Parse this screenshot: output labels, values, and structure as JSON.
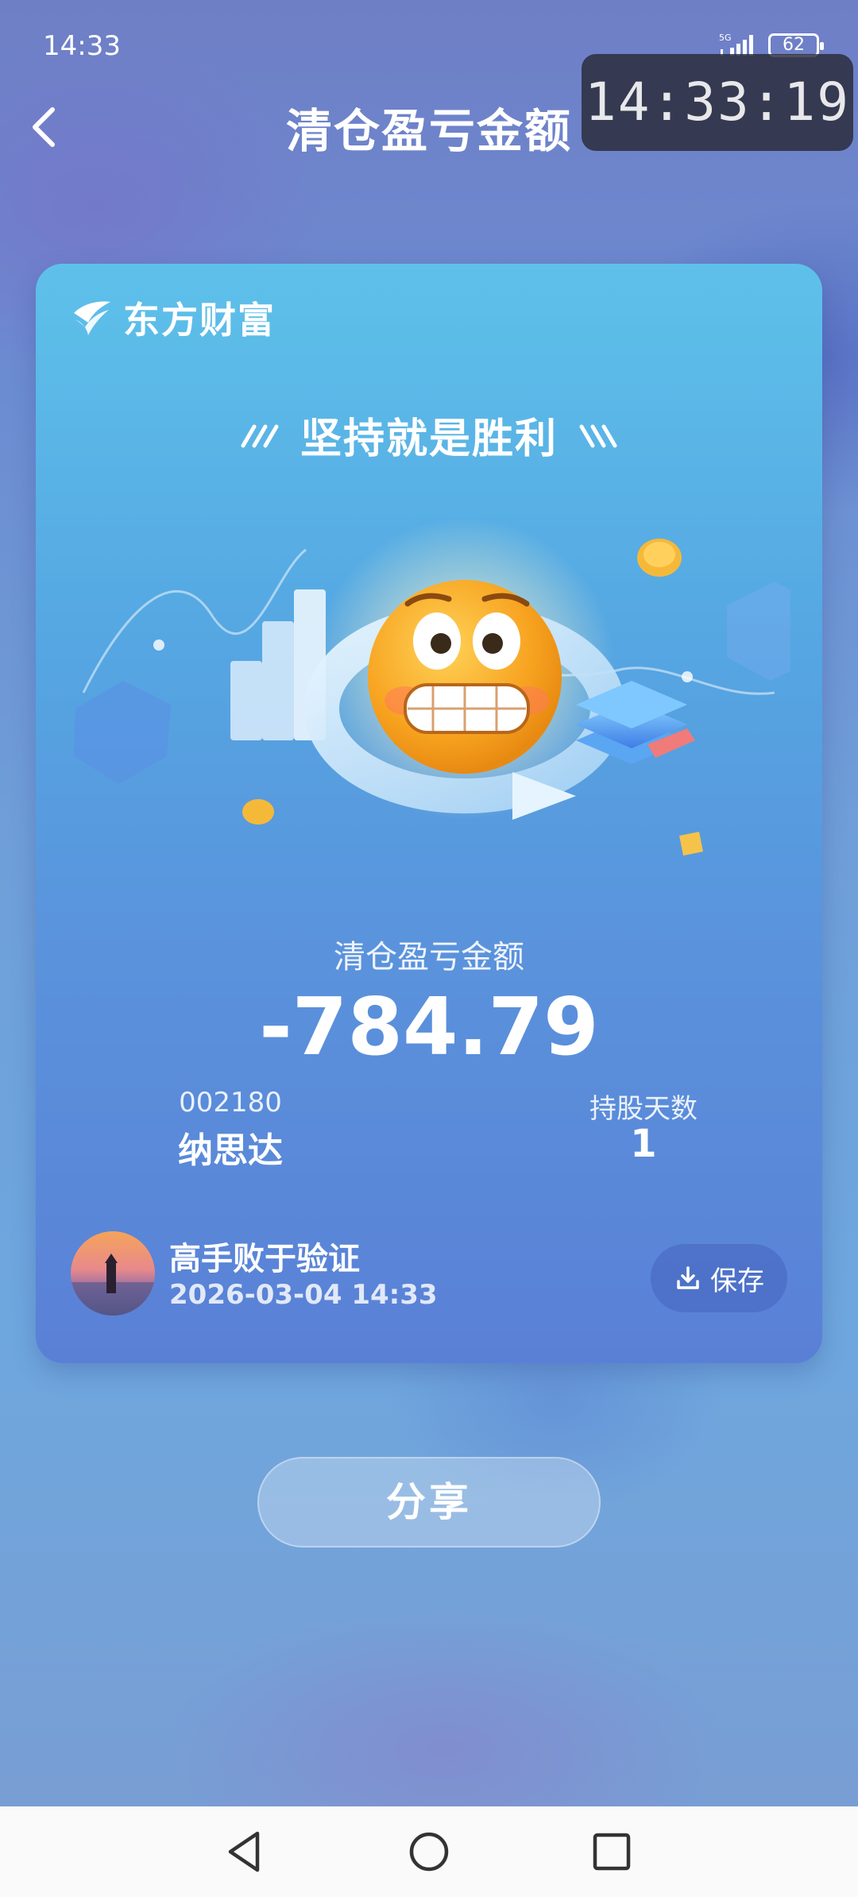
{
  "status_bar": {
    "time": "14:33",
    "network": "5G",
    "battery": "62"
  },
  "overlay_clock": "14:33:19",
  "header": {
    "title": "清仓盈亏金额"
  },
  "card": {
    "brand": "东方财富",
    "slogan": "坚持就是胜利",
    "amount_label": "清仓盈亏金额",
    "amount": "-784.79",
    "stock_code": "002180",
    "stock_name": "纳思达",
    "holding_days_label": "持股天数",
    "holding_days": "1",
    "user_name": "高手败于验证",
    "timestamp": "2026-03-04 14:33",
    "save_label": "保存"
  },
  "share_label": "分享",
  "colors": {
    "card_top": "#5ec1ea",
    "card_bottom": "#5a80d6",
    "accent_coin": "#f5b93a",
    "emoji_face": "#f7a21f"
  },
  "icons": [
    "back-arrow-icon",
    "signal-icon",
    "battery-icon",
    "brand-logo-icon",
    "download-icon",
    "nav-back-icon",
    "nav-home-icon",
    "nav-recent-icon"
  ]
}
